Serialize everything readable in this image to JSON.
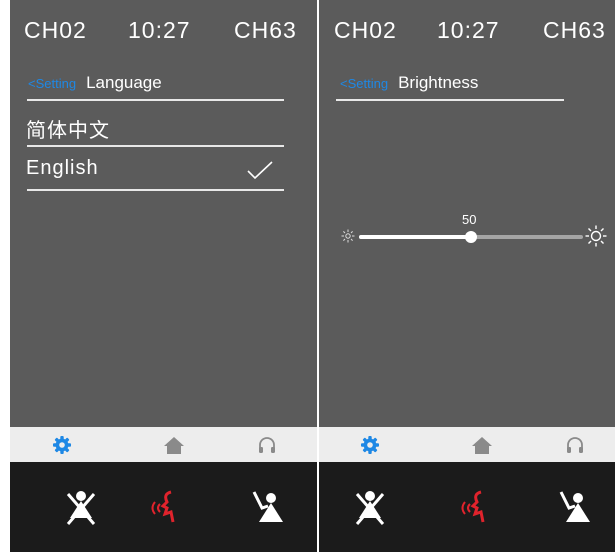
{
  "left": {
    "status": {
      "channel_left": "CH02",
      "time": "10:27",
      "channel_right": "CH63"
    },
    "header": {
      "back_label": "<Setting",
      "title": "Language"
    },
    "languages": [
      {
        "label": "简体中文",
        "selected": false
      },
      {
        "label": "English",
        "selected": true
      }
    ],
    "tabs": [
      "settings-gear",
      "home",
      "headphones"
    ],
    "active_tab": "settings-gear"
  },
  "right": {
    "status": {
      "channel_left": "CH02",
      "time": "10:27",
      "channel_right": "CH63"
    },
    "header": {
      "back_label": "<Setting",
      "title": "Brightness"
    },
    "brightness": {
      "value": "50",
      "fraction": 0.5
    },
    "tabs": [
      "settings-gear",
      "home",
      "headphones"
    ],
    "active_tab": "settings-gear"
  },
  "colors": {
    "screen_bg": "#5b5b5b",
    "tabbar_bg": "#ededed",
    "callbar_bg": "#1b1b1b",
    "accent_blue": "#1e88e5",
    "talk_red": "#e0232c",
    "icon_gray": "#8a8a8a"
  }
}
